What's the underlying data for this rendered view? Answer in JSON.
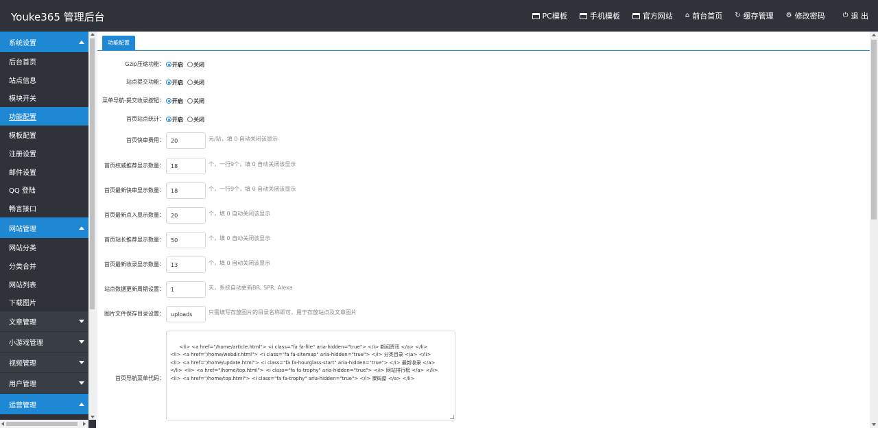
{
  "header": {
    "brand": "Youke365 管理后台",
    "nav": [
      {
        "label": "PC模板",
        "icon": "desktop-icon"
      },
      {
        "label": "手机模板",
        "icon": "mobile-icon"
      },
      {
        "label": "官方网站",
        "icon": "window-icon"
      },
      {
        "label": "前台首页",
        "icon": "home-icon"
      },
      {
        "label": "缓存管理",
        "icon": "refresh-icon"
      },
      {
        "label": "修改密码",
        "icon": "gear-icon"
      },
      {
        "label": "退 出",
        "icon": "power-icon"
      }
    ]
  },
  "sidebar": {
    "groups": [
      {
        "label": "系统设置",
        "open": true,
        "items": [
          "后台首页",
          "站点信息",
          "模块开关",
          "功能配置",
          "模板配置",
          "注册设置",
          "邮件设置",
          "QQ 登陆",
          "畅言接口"
        ],
        "active": "功能配置"
      },
      {
        "label": "网站管理",
        "open": true,
        "items": [
          "网站分类",
          "分类合并",
          "网站列表",
          "下载图片"
        ]
      },
      {
        "label": "文章管理",
        "open": false
      },
      {
        "label": "小游戏管理",
        "open": false
      },
      {
        "label": "视频管理",
        "open": false
      },
      {
        "label": "用户管理",
        "open": false
      },
      {
        "label": "运营管理",
        "open": true
      }
    ]
  },
  "tab": {
    "label": "功能配置"
  },
  "radio_settings": [
    {
      "label": "Gzip压缩功能：",
      "on_label": "开启",
      "off_label": "关闭",
      "value": "开启"
    },
    {
      "label": "站点提交功能：",
      "on_label": "开启",
      "off_label": "关闭",
      "value": "开启"
    },
    {
      "label": "菜单导航-提交收录按钮：",
      "on_label": "开启",
      "off_label": "关闭",
      "value": "开启"
    },
    {
      "label": "首页站点统计：",
      "on_label": "开启",
      "off_label": "关闭",
      "value": "开启"
    }
  ],
  "field_settings": [
    {
      "label": "首页快审费用：",
      "value": "20",
      "hint": "元/站，填 0 自动关闭该显示"
    },
    {
      "label": "首页权威推荐显示数量：",
      "value": "18",
      "hint": "个，一行9个，填 0 自动关闭该显示"
    },
    {
      "label": "首页最新快审显示数量：",
      "value": "18",
      "hint": "个，一行9个，填 0 自动关闭该显示"
    },
    {
      "label": "首页最新点入显示数量：",
      "value": "20",
      "hint": "个，填 0 自动关闭该显示"
    },
    {
      "label": "首页站长推荐显示数量：",
      "value": "50",
      "hint": "个，填 0 自动关闭该显示"
    },
    {
      "label": "首页最新收录显示数量：",
      "value": "13",
      "hint": "个，填 0 自动关闭该显示"
    },
    {
      "label": "站点数据更新周期设置：",
      "value": "1",
      "hint": "天，系统自动更新BR, SPR, Alexa"
    },
    {
      "label": "图片文件保存目录设置：",
      "value": "uploads",
      "hint": "只需填写存放图片的目录名称即可，用于存放站点及文章图片"
    }
  ],
  "menu_code": {
    "label": "首页导航菜单代码：",
    "value": "<li> <a href=\"/home/article.html\"> <i class=\"fa fa-file\" aria-hidden=\"true\"> </i> 新闻资讯 </a> </li>\n<li> <a href=\"/home/webdir.html\"> <i class=\"fa fa-sitemap\" aria-hidden=\"true\"> </i> 分类目录 </a> </li>\n<li> <a href=\"/home/update.html\"> <i class=\"fa fa-hourglass-start\" aria-hidden=\"true\"> </i> 最新收录 </a>\n</li> <li> <a href=\"/home/top.html\"> <i class=\"fa fa-trophy\" aria-hidden=\"true\"> </i> 网站排行榜 </a> </li>\n<li> <a href=\"/home/top.html\"> <i class=\"fa fa-trophy\" aria-hidden=\"true\"> </i> 聚码屋 </a> </li>"
  },
  "colors": {
    "accent": "#1e88d4",
    "dark": "#2f3339"
  }
}
